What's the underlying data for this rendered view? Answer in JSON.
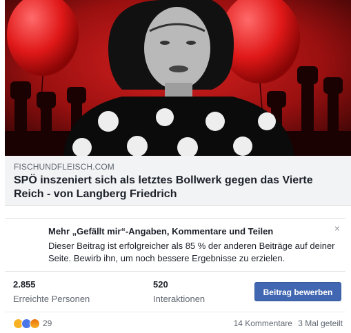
{
  "link": {
    "domain": "FISCHUNDFLEISCH.COM",
    "headline": "SPÖ inszeniert sich als letztes Bollwerk gegen das Vierte Reich - von Langberg Friedrich"
  },
  "promo": {
    "title": "Mehr „Gefällt mir“-Angaben, Kommentare und Teilen",
    "text": "Dieser Beitrag ist erfolgreicher als 85 % der anderen Beiträge auf deiner Seite. Bewirb ihn, um noch bessere Ergebnisse zu erzielen.",
    "close": "×"
  },
  "stats": {
    "reach_value": "2.855",
    "reach_label": "Erreichte Personen",
    "interactions_value": "520",
    "interactions_label": "Interaktionen",
    "boost_label": "Beitrag bewerben"
  },
  "footer": {
    "reaction_icons": [
      "haha-icon",
      "like-icon",
      "angry-icon"
    ],
    "reaction_count": "29",
    "comments": "14 Kommentare",
    "shares": "3 Mal geteilt"
  },
  "colors": {
    "accent": "#4267b2",
    "hero_red": "#c61a1a"
  }
}
